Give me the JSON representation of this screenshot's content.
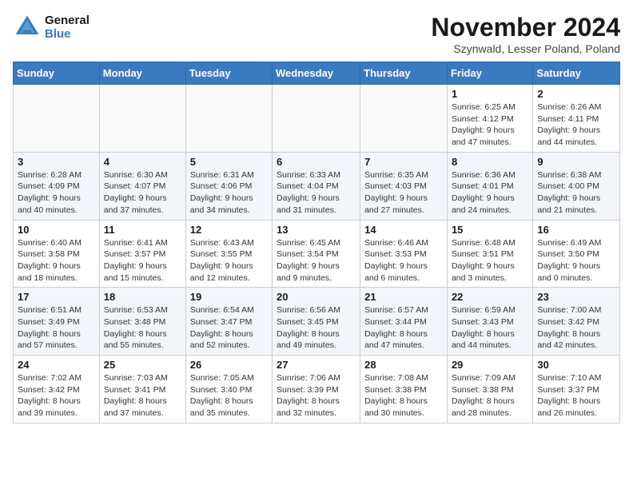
{
  "logo": {
    "line1": "General",
    "line2": "Blue"
  },
  "title": "November 2024",
  "subtitle": "Szynwald, Lesser Poland, Poland",
  "days_of_week": [
    "Sunday",
    "Monday",
    "Tuesday",
    "Wednesday",
    "Thursday",
    "Friday",
    "Saturday"
  ],
  "weeks": [
    [
      {
        "day": "",
        "info": ""
      },
      {
        "day": "",
        "info": ""
      },
      {
        "day": "",
        "info": ""
      },
      {
        "day": "",
        "info": ""
      },
      {
        "day": "",
        "info": ""
      },
      {
        "day": "1",
        "info": "Sunrise: 6:25 AM\nSunset: 4:12 PM\nDaylight: 9 hours\nand 47 minutes."
      },
      {
        "day": "2",
        "info": "Sunrise: 6:26 AM\nSunset: 4:11 PM\nDaylight: 9 hours\nand 44 minutes."
      }
    ],
    [
      {
        "day": "3",
        "info": "Sunrise: 6:28 AM\nSunset: 4:09 PM\nDaylight: 9 hours\nand 40 minutes."
      },
      {
        "day": "4",
        "info": "Sunrise: 6:30 AM\nSunset: 4:07 PM\nDaylight: 9 hours\nand 37 minutes."
      },
      {
        "day": "5",
        "info": "Sunrise: 6:31 AM\nSunset: 4:06 PM\nDaylight: 9 hours\nand 34 minutes."
      },
      {
        "day": "6",
        "info": "Sunrise: 6:33 AM\nSunset: 4:04 PM\nDaylight: 9 hours\nand 31 minutes."
      },
      {
        "day": "7",
        "info": "Sunrise: 6:35 AM\nSunset: 4:03 PM\nDaylight: 9 hours\nand 27 minutes."
      },
      {
        "day": "8",
        "info": "Sunrise: 6:36 AM\nSunset: 4:01 PM\nDaylight: 9 hours\nand 24 minutes."
      },
      {
        "day": "9",
        "info": "Sunrise: 6:38 AM\nSunset: 4:00 PM\nDaylight: 9 hours\nand 21 minutes."
      }
    ],
    [
      {
        "day": "10",
        "info": "Sunrise: 6:40 AM\nSunset: 3:58 PM\nDaylight: 9 hours\nand 18 minutes."
      },
      {
        "day": "11",
        "info": "Sunrise: 6:41 AM\nSunset: 3:57 PM\nDaylight: 9 hours\nand 15 minutes."
      },
      {
        "day": "12",
        "info": "Sunrise: 6:43 AM\nSunset: 3:55 PM\nDaylight: 9 hours\nand 12 minutes."
      },
      {
        "day": "13",
        "info": "Sunrise: 6:45 AM\nSunset: 3:54 PM\nDaylight: 9 hours\nand 9 minutes."
      },
      {
        "day": "14",
        "info": "Sunrise: 6:46 AM\nSunset: 3:53 PM\nDaylight: 9 hours\nand 6 minutes."
      },
      {
        "day": "15",
        "info": "Sunrise: 6:48 AM\nSunset: 3:51 PM\nDaylight: 9 hours\nand 3 minutes."
      },
      {
        "day": "16",
        "info": "Sunrise: 6:49 AM\nSunset: 3:50 PM\nDaylight: 9 hours\nand 0 minutes."
      }
    ],
    [
      {
        "day": "17",
        "info": "Sunrise: 6:51 AM\nSunset: 3:49 PM\nDaylight: 8 hours\nand 57 minutes."
      },
      {
        "day": "18",
        "info": "Sunrise: 6:53 AM\nSunset: 3:48 PM\nDaylight: 8 hours\nand 55 minutes."
      },
      {
        "day": "19",
        "info": "Sunrise: 6:54 AM\nSunset: 3:47 PM\nDaylight: 8 hours\nand 52 minutes."
      },
      {
        "day": "20",
        "info": "Sunrise: 6:56 AM\nSunset: 3:45 PM\nDaylight: 8 hours\nand 49 minutes."
      },
      {
        "day": "21",
        "info": "Sunrise: 6:57 AM\nSunset: 3:44 PM\nDaylight: 8 hours\nand 47 minutes."
      },
      {
        "day": "22",
        "info": "Sunrise: 6:59 AM\nSunset: 3:43 PM\nDaylight: 8 hours\nand 44 minutes."
      },
      {
        "day": "23",
        "info": "Sunrise: 7:00 AM\nSunset: 3:42 PM\nDaylight: 8 hours\nand 42 minutes."
      }
    ],
    [
      {
        "day": "24",
        "info": "Sunrise: 7:02 AM\nSunset: 3:42 PM\nDaylight: 8 hours\nand 39 minutes."
      },
      {
        "day": "25",
        "info": "Sunrise: 7:03 AM\nSunset: 3:41 PM\nDaylight: 8 hours\nand 37 minutes."
      },
      {
        "day": "26",
        "info": "Sunrise: 7:05 AM\nSunset: 3:40 PM\nDaylight: 8 hours\nand 35 minutes."
      },
      {
        "day": "27",
        "info": "Sunrise: 7:06 AM\nSunset: 3:39 PM\nDaylight: 8 hours\nand 32 minutes."
      },
      {
        "day": "28",
        "info": "Sunrise: 7:08 AM\nSunset: 3:38 PM\nDaylight: 8 hours\nand 30 minutes."
      },
      {
        "day": "29",
        "info": "Sunrise: 7:09 AM\nSunset: 3:38 PM\nDaylight: 8 hours\nand 28 minutes."
      },
      {
        "day": "30",
        "info": "Sunrise: 7:10 AM\nSunset: 3:37 PM\nDaylight: 8 hours\nand 26 minutes."
      }
    ]
  ]
}
